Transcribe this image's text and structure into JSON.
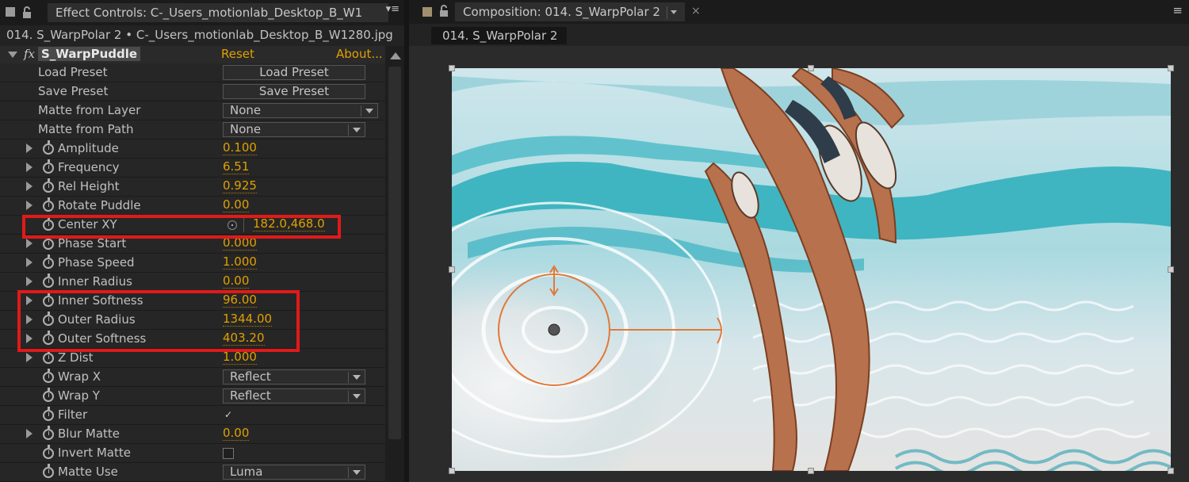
{
  "effect_controls": {
    "tab_title": "Effect Controls: C-_Users_motionlab_Desktop_B_W1",
    "source": "014. S_WarpPolar 2 • C-_Users_motionlab_Desktop_B_W1280.jpg",
    "effect": {
      "name": "S_WarpPuddle",
      "fx_label": "fx",
      "reset": "Reset",
      "about": "About..."
    },
    "rows": [
      {
        "label": "Load Preset",
        "control": "Load Preset"
      },
      {
        "label": "Save Preset",
        "control": "Save Preset"
      },
      {
        "label": "Matte from Layer",
        "control": "None"
      },
      {
        "label": "Matte from Path",
        "control": "None"
      },
      {
        "label": "Amplitude",
        "value": "0.100"
      },
      {
        "label": "Frequency",
        "value": "6.51"
      },
      {
        "label": "Rel Height",
        "value": "0.925"
      },
      {
        "label": "Rotate Puddle",
        "value": "0.00"
      },
      {
        "label": "Center XY",
        "value": "182.0,468.0"
      },
      {
        "label": "Phase Start",
        "value": "0.000"
      },
      {
        "label": "Phase Speed",
        "value": "1.000"
      },
      {
        "label": "Inner Radius",
        "value": "0.00"
      },
      {
        "label": "Inner Softness",
        "value": "96.00"
      },
      {
        "label": "Outer Radius",
        "value": "1344.00"
      },
      {
        "label": "Outer Softness",
        "value": "403.20"
      },
      {
        "label": "Z Dist",
        "value": "1.000"
      },
      {
        "label": "Wrap X",
        "control": "Reflect"
      },
      {
        "label": "Wrap Y",
        "control": "Reflect"
      },
      {
        "label": "Filter",
        "checked": true,
        "check_glyph": "✓"
      },
      {
        "label": "Blur Matte",
        "value": "0.00"
      },
      {
        "label": "Invert Matte",
        "checked": false
      },
      {
        "label": "Matte Use",
        "control": "Luma"
      }
    ]
  },
  "composition": {
    "tab_title": "Composition: 014. S_WarpPolar 2",
    "subtab": "014. S_WarpPolar 2"
  },
  "colors": {
    "accent_value": "#e0a000",
    "highlight": "#e01a1a",
    "gizmo": "#e07a3a"
  },
  "icons": {
    "panel_menu": "≡",
    "close": "×"
  }
}
